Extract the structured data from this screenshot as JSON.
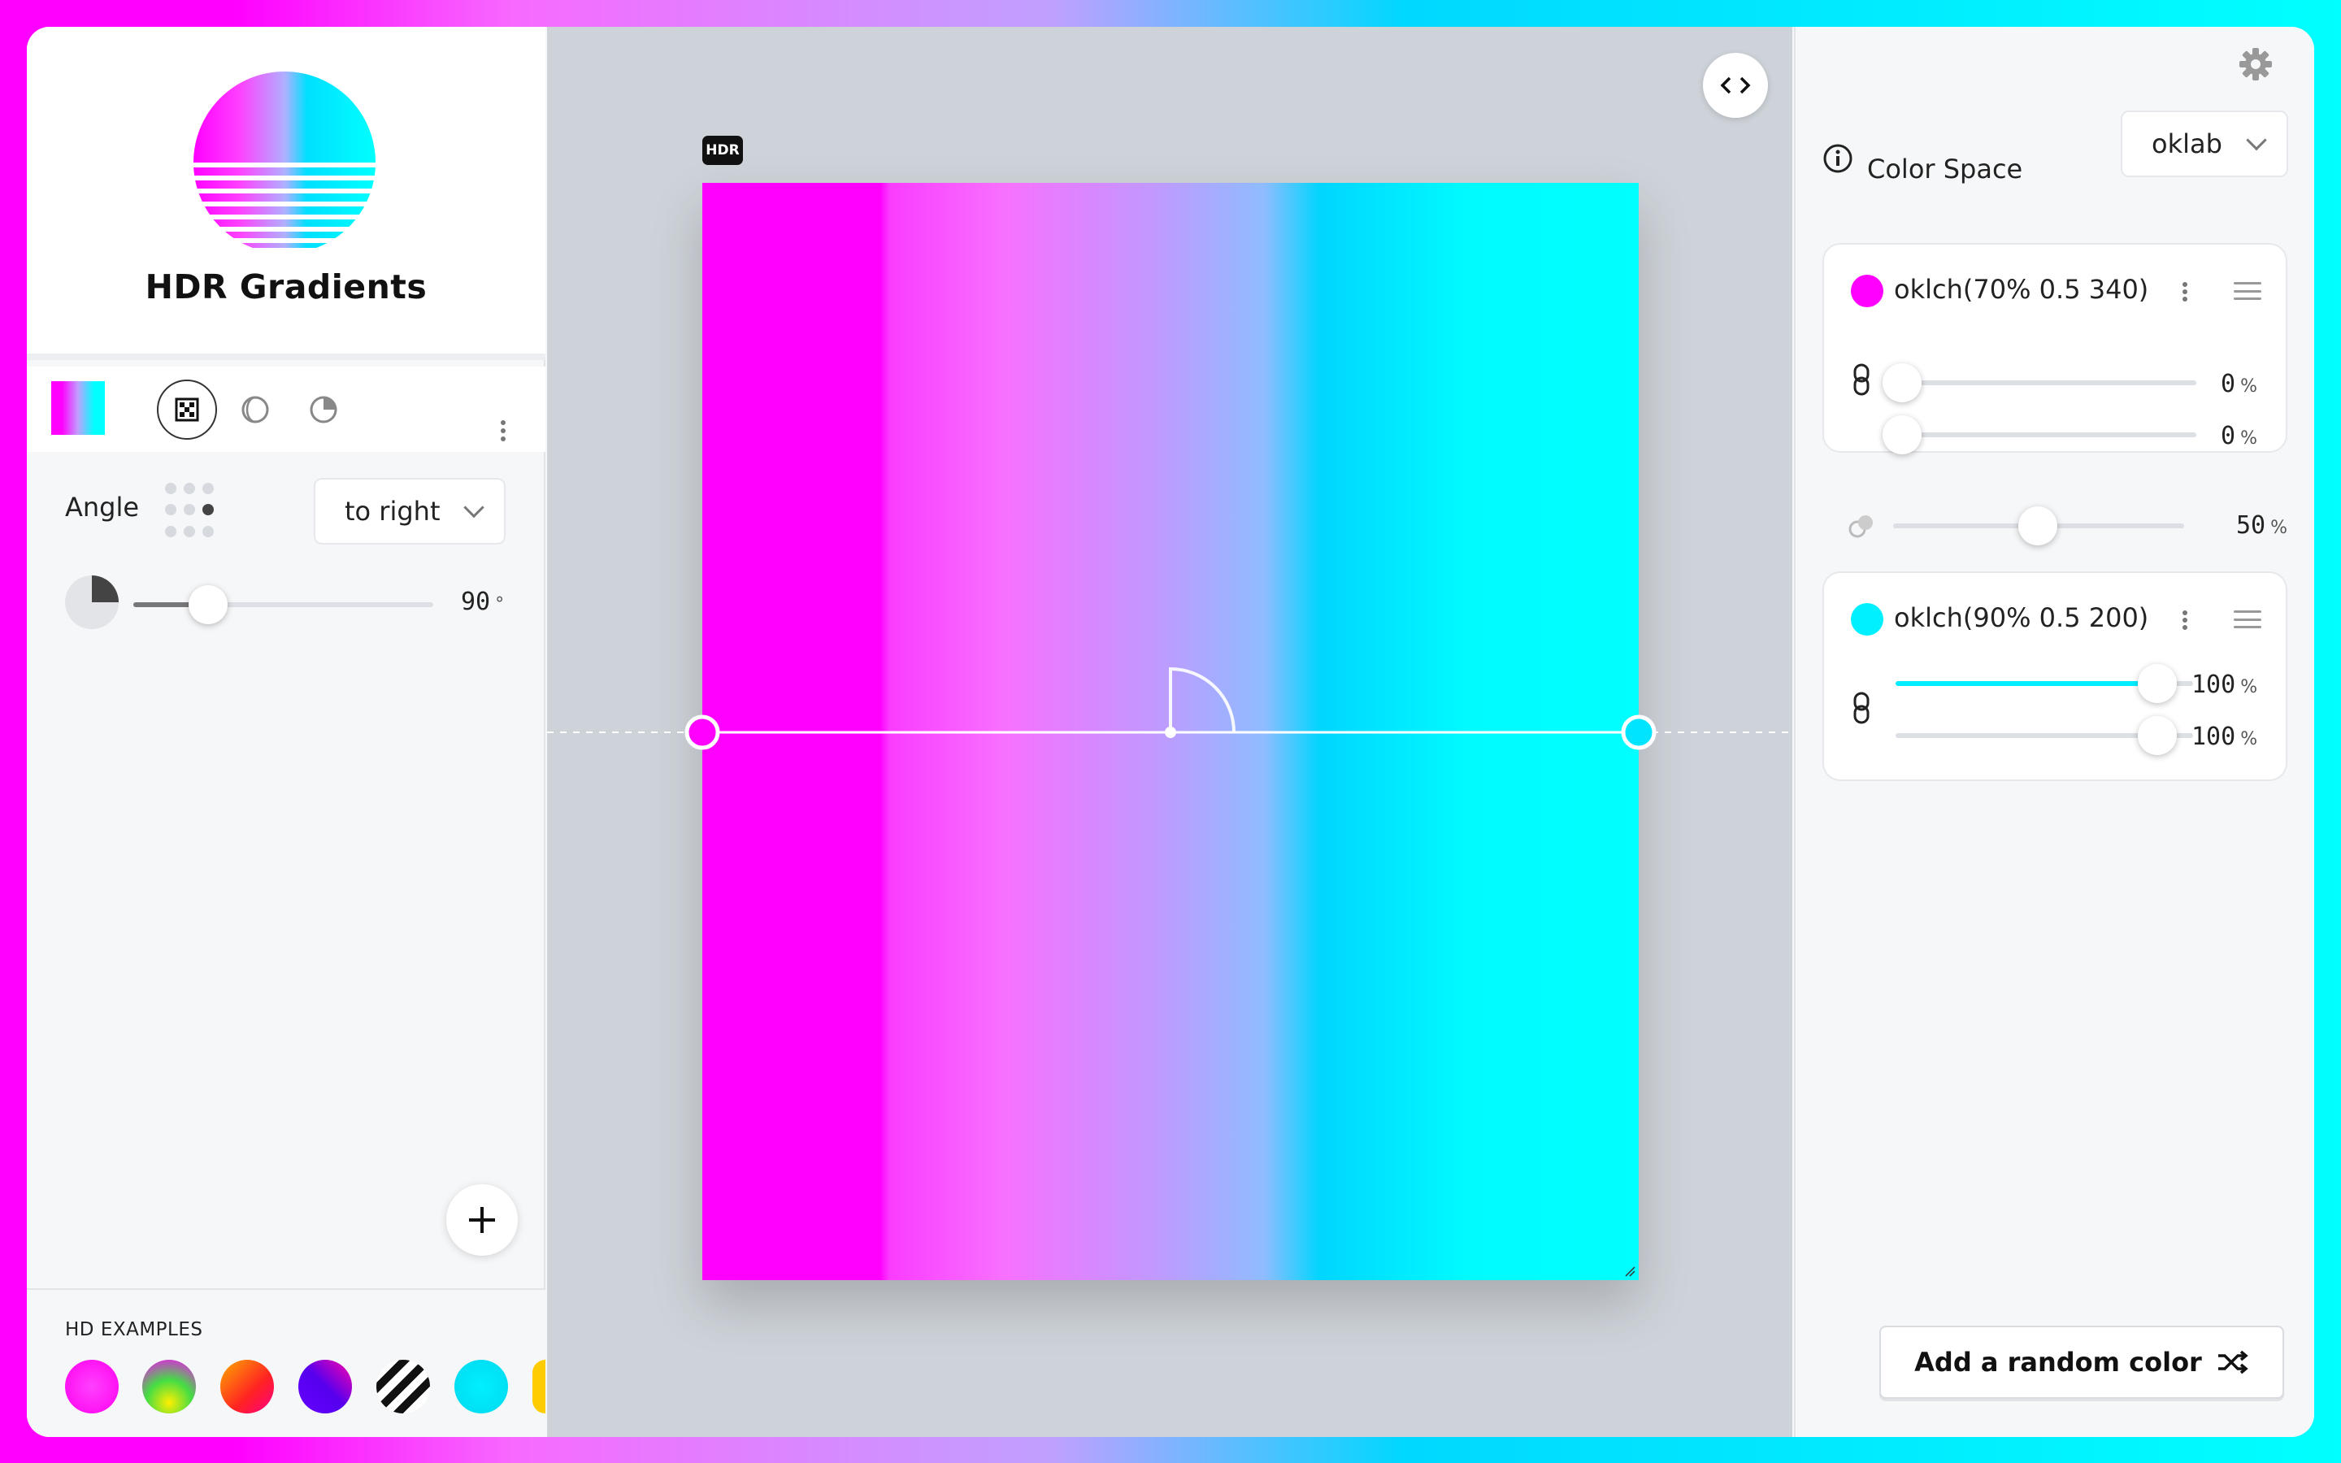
{
  "brand": {
    "title": "HDR Gradients"
  },
  "controls": {
    "angle_label": "Angle",
    "direction_value": "to right",
    "angle_value": "90",
    "angle_unit": "°",
    "angle_fraction": 0.25
  },
  "examples": {
    "title": "HD EXAMPLES"
  },
  "canvas": {
    "hdr_badge": "HDR"
  },
  "color_space": {
    "label": "Color Space",
    "value": "oklab"
  },
  "stops": [
    {
      "label": "oklch(70% 0.5 340)",
      "color": "#ff00ff",
      "pos1": "0",
      "pos2": "0",
      "unit": "%"
    },
    {
      "label": "oklch(90% 0.5 200)",
      "color": "#00f0ff",
      "pos1": "100",
      "pos2": "100",
      "unit": "%"
    }
  ],
  "midpoint": {
    "value": "50",
    "unit": "%"
  },
  "random_button": {
    "label": "Add a random color"
  },
  "colors": {
    "magenta": "#ff00ff",
    "cyan": "#00ffff",
    "accent_cyan": "#00f0ff"
  }
}
